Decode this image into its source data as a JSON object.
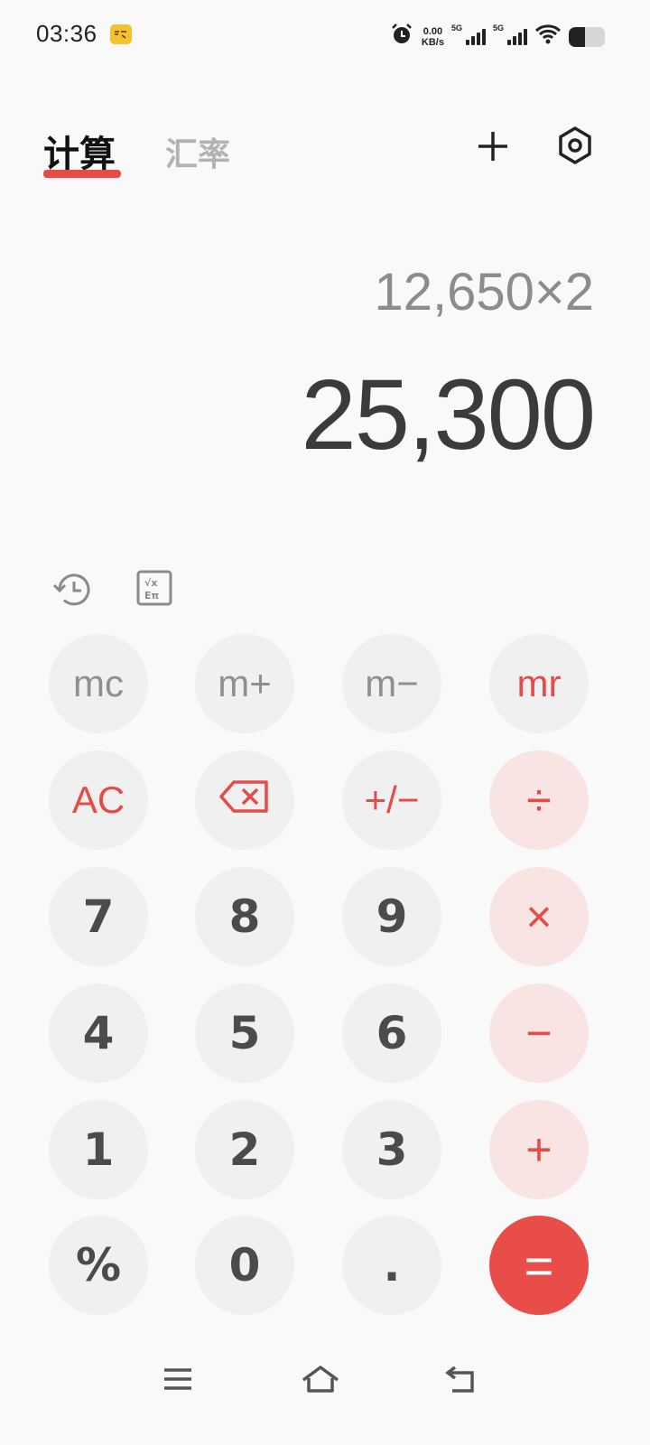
{
  "status_bar": {
    "time": "03:36",
    "net_speed_value": "0.00",
    "net_speed_unit": "KB/s",
    "signal1_label": "5G",
    "signal2_label": "5G",
    "battery_level": 0.45,
    "icons": [
      "app-badge-icon",
      "alarm-icon",
      "signal-icon",
      "signal-icon",
      "wifi-icon",
      "battery-icon"
    ]
  },
  "tabs": [
    {
      "label": "计算",
      "active": true
    },
    {
      "label": "汇率",
      "active": false
    }
  ],
  "accent_color": "#e84a48",
  "display": {
    "expression": "12,650×2",
    "result": "25,300"
  },
  "keypad": {
    "row1": [
      "mc",
      "m+",
      "m−",
      "mr"
    ],
    "row2": [
      "AC",
      "⌫",
      "+/−",
      "÷"
    ],
    "row3": [
      "7",
      "8",
      "9",
      "×"
    ],
    "row4": [
      "4",
      "5",
      "6",
      "−"
    ],
    "row5": [
      "1",
      "2",
      "3",
      "+"
    ],
    "row6": [
      "%",
      "0",
      ".",
      "="
    ]
  }
}
